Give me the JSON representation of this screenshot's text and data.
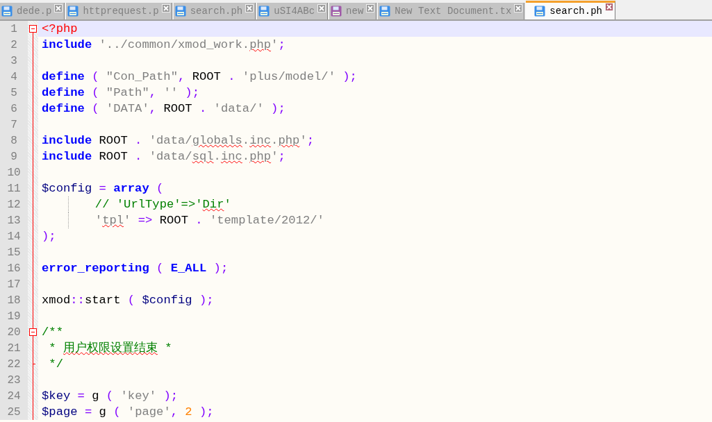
{
  "tabs": [
    {
      "label": "dede.p",
      "selected": false,
      "color": "#3a8ee8"
    },
    {
      "label": "httprequest.p",
      "selected": false,
      "color": "#3a8ee8"
    },
    {
      "label": "search.ph",
      "selected": false,
      "color": "#3a8ee8"
    },
    {
      "label": "uSI4ABc",
      "selected": false,
      "color": "#3a8ee8"
    },
    {
      "label": "new",
      "selected": false,
      "color": "#a05aa8"
    },
    {
      "label": "New Text Document.tx",
      "selected": false,
      "color": "#3a8ee8"
    },
    {
      "label": "search.ph",
      "selected": true,
      "color": "#3a8ee8"
    }
  ],
  "editor": {
    "lines": [
      {
        "number": "1",
        "fold_start": true,
        "fold_end": false,
        "current": true,
        "tokens": [
          {
            "kind": "tag",
            "text": "<?php"
          }
        ]
      },
      {
        "number": "2",
        "fold_start": false,
        "fold_end": false,
        "current": false,
        "tokens": [
          {
            "kind": "keyword",
            "text": "include"
          },
          {
            "kind": "string",
            "text": " '../common/xmod_work."
          },
          {
            "kind": "string",
            "text": "php",
            "misspelled": true
          },
          {
            "kind": "string",
            "text": "'"
          },
          {
            "kind": "operator",
            "text": ";"
          }
        ]
      },
      {
        "number": "3",
        "fold_start": false,
        "fold_end": false,
        "current": false
      },
      {
        "number": "4",
        "fold_start": false,
        "fold_end": false,
        "current": false,
        "tokens": [
          {
            "kind": "keyword",
            "text": "define"
          },
          {
            "kind": "operator",
            "text": " ( "
          },
          {
            "kind": "string",
            "text": "\"Con_Path\""
          },
          {
            "kind": "operator",
            "text": ", "
          },
          {
            "kind": "plain",
            "text": "ROOT"
          },
          {
            "kind": "operator",
            "text": " . "
          },
          {
            "kind": "string",
            "text": "'plus/model/'"
          },
          {
            "kind": "operator",
            "text": " );"
          }
        ]
      },
      {
        "number": "5",
        "fold_start": false,
        "fold_end": false,
        "current": false,
        "tokens": [
          {
            "kind": "keyword",
            "text": "define"
          },
          {
            "kind": "operator",
            "text": " ( "
          },
          {
            "kind": "string",
            "text": "\"Path\""
          },
          {
            "kind": "operator",
            "text": ", "
          },
          {
            "kind": "string",
            "text": "''"
          },
          {
            "kind": "operator",
            "text": " );"
          }
        ]
      },
      {
        "number": "6",
        "fold_start": false,
        "fold_end": false,
        "current": false,
        "tokens": [
          {
            "kind": "keyword",
            "text": "define"
          },
          {
            "kind": "operator",
            "text": " ( "
          },
          {
            "kind": "string",
            "text": "'DATA'"
          },
          {
            "kind": "operator",
            "text": ", "
          },
          {
            "kind": "plain",
            "text": "ROOT"
          },
          {
            "kind": "operator",
            "text": " . "
          },
          {
            "kind": "string",
            "text": "'data/'"
          },
          {
            "kind": "operator",
            "text": " );"
          }
        ]
      },
      {
        "number": "7",
        "fold_start": false,
        "fold_end": false,
        "current": false
      },
      {
        "number": "8",
        "fold_start": false,
        "fold_end": false,
        "current": false,
        "tokens": [
          {
            "kind": "keyword",
            "text": "include"
          },
          {
            "kind": "plain",
            "text": " ROOT"
          },
          {
            "kind": "operator",
            "text": " . "
          },
          {
            "kind": "string",
            "text": "'data/"
          },
          {
            "kind": "string",
            "text": "globals",
            "misspelled": true
          },
          {
            "kind": "string",
            "text": "."
          },
          {
            "kind": "string",
            "text": "inc",
            "misspelled": true
          },
          {
            "kind": "string",
            "text": "."
          },
          {
            "kind": "string",
            "text": "php",
            "misspelled": true
          },
          {
            "kind": "string",
            "text": "'"
          },
          {
            "kind": "operator",
            "text": ";"
          }
        ]
      },
      {
        "number": "9",
        "fold_start": false,
        "fold_end": false,
        "current": false,
        "tokens": [
          {
            "kind": "keyword",
            "text": "include"
          },
          {
            "kind": "plain",
            "text": " ROOT"
          },
          {
            "kind": "operator",
            "text": " . "
          },
          {
            "kind": "string",
            "text": "'data/"
          },
          {
            "kind": "string",
            "text": "sql",
            "misspelled": true
          },
          {
            "kind": "string",
            "text": "."
          },
          {
            "kind": "string",
            "text": "inc",
            "misspelled": true
          },
          {
            "kind": "string",
            "text": "."
          },
          {
            "kind": "string",
            "text": "php",
            "misspelled": true
          },
          {
            "kind": "string",
            "text": "'"
          },
          {
            "kind": "operator",
            "text": ";"
          }
        ]
      },
      {
        "number": "10",
        "fold_start": false,
        "fold_end": false,
        "current": false
      },
      {
        "number": "11",
        "fold_start": false,
        "fold_end": false,
        "current": false,
        "tokens": [
          {
            "kind": "variable",
            "text": "$config"
          },
          {
            "kind": "operator",
            "text": " = "
          },
          {
            "kind": "keyword",
            "text": "array"
          },
          {
            "kind": "operator",
            "text": " ("
          }
        ]
      },
      {
        "number": "12",
        "fold_start": false,
        "fold_end": false,
        "current": false,
        "indent_guide": true,
        "tokens": [
          {
            "kind": "comment",
            "text": "// 'UrlType'=>'"
          },
          {
            "kind": "comment",
            "text": "Dir",
            "misspelled": true
          },
          {
            "kind": "comment",
            "text": "'"
          }
        ]
      },
      {
        "number": "13",
        "fold_start": false,
        "fold_end": false,
        "current": false,
        "indent_guide": true,
        "tokens": [
          {
            "kind": "string",
            "text": "'"
          },
          {
            "kind": "string",
            "text": "tpl",
            "misspelled": true
          },
          {
            "kind": "string",
            "text": "'"
          },
          {
            "kind": "operator",
            "text": " => "
          },
          {
            "kind": "plain",
            "text": "ROOT"
          },
          {
            "kind": "operator",
            "text": " . "
          },
          {
            "kind": "string",
            "text": "'template/2012/'"
          }
        ]
      },
      {
        "number": "14",
        "fold_start": false,
        "fold_end": false,
        "current": false,
        "tokens": [
          {
            "kind": "operator",
            "text": ");"
          }
        ]
      },
      {
        "number": "15",
        "fold_start": false,
        "fold_end": false,
        "current": false
      },
      {
        "number": "16",
        "fold_start": false,
        "fold_end": false,
        "current": false,
        "tokens": [
          {
            "kind": "keyword",
            "text": "error_reporting"
          },
          {
            "kind": "operator",
            "text": " ( "
          },
          {
            "kind": "keyword",
            "text": "E_ALL"
          },
          {
            "kind": "operator",
            "text": " );"
          }
        ]
      },
      {
        "number": "17",
        "fold_start": false,
        "fold_end": false,
        "current": false
      },
      {
        "number": "18",
        "fold_start": false,
        "fold_end": false,
        "current": false,
        "tokens": [
          {
            "kind": "plain",
            "text": "xmod"
          },
          {
            "kind": "operator",
            "text": "::"
          },
          {
            "kind": "plain",
            "text": "start"
          },
          {
            "kind": "operator",
            "text": " ( "
          },
          {
            "kind": "variable",
            "text": "$config"
          },
          {
            "kind": "operator",
            "text": " );"
          }
        ]
      },
      {
        "number": "19",
        "fold_start": false,
        "fold_end": false,
        "current": false
      },
      {
        "number": "20",
        "fold_start": true,
        "fold_end": false,
        "current": false,
        "tokens": [
          {
            "kind": "comment",
            "text": "/**"
          }
        ]
      },
      {
        "number": "21",
        "fold_start": false,
        "fold_end": false,
        "current": false,
        "tokens": [
          {
            "kind": "comment",
            "text": " * "
          },
          {
            "kind": "comment",
            "text": "用户权限设置结束",
            "misspelled": true
          },
          {
            "kind": "comment",
            "text": " *"
          }
        ]
      },
      {
        "number": "22",
        "fold_start": false,
        "fold_end": true,
        "current": false,
        "tokens": [
          {
            "kind": "comment",
            "text": " */"
          }
        ]
      },
      {
        "number": "23",
        "fold_start": false,
        "fold_end": false,
        "current": false
      },
      {
        "number": "24",
        "fold_start": false,
        "fold_end": false,
        "current": false,
        "tokens": [
          {
            "kind": "variable",
            "text": "$key"
          },
          {
            "kind": "operator",
            "text": " = "
          },
          {
            "kind": "plain",
            "text": "g"
          },
          {
            "kind": "operator",
            "text": " ( "
          },
          {
            "kind": "string",
            "text": "'key'"
          },
          {
            "kind": "operator",
            "text": " );"
          }
        ]
      },
      {
        "number": "25",
        "fold_start": false,
        "fold_end": false,
        "current": false,
        "tokens": [
          {
            "kind": "variable",
            "text": "$page"
          },
          {
            "kind": "operator",
            "text": " = "
          },
          {
            "kind": "plain",
            "text": "g"
          },
          {
            "kind": "operator",
            "text": " ( "
          },
          {
            "kind": "string",
            "text": "'page'"
          },
          {
            "kind": "operator",
            "text": ", "
          },
          {
            "kind": "number",
            "text": "2"
          },
          {
            "kind": "operator",
            "text": " );"
          }
        ]
      }
    ]
  }
}
